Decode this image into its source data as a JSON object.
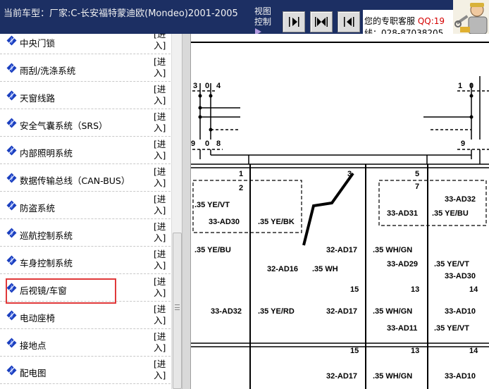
{
  "header": {
    "title": "当前车型：厂家:C-长安福特蒙迪欧(Mondeo)2001-2005",
    "view_control_label": "视图控制",
    "service_label": "您的专职客服",
    "service_qq": "QQ:19",
    "service_phone": "线：028-87038205"
  },
  "sidebar": {
    "enter_label": "[进入]",
    "items": [
      {
        "label": "中央门锁"
      },
      {
        "label": "雨刮/洗涤系统"
      },
      {
        "label": "天窗线路"
      },
      {
        "label": "安全气囊系统（SRS）"
      },
      {
        "label": "内部照明系统"
      },
      {
        "label": "数据传输总线（CAN-BUS）"
      },
      {
        "label": "防盗系统"
      },
      {
        "label": "巡航控制系统"
      },
      {
        "label": "车身控制系统"
      },
      {
        "label": "后视镜/车窗",
        "highlighted": true
      },
      {
        "label": "电动座椅"
      },
      {
        "label": "接地点"
      },
      {
        "label": "配电图"
      }
    ]
  },
  "diagram": {
    "connector_top_left": {
      "pin_a": "3",
      "pin_b": "0",
      "pin_c": "4"
    },
    "connector_top_right": {
      "pin_a": "1",
      "pin_b": "0"
    },
    "connector_mid_left": {
      "pin_a": "9",
      "pin_b": "0",
      "pin_c": "8"
    },
    "connector_mid_right": {
      "pin_a": "9"
    },
    "pins": {
      "p1": "1",
      "p2": "2",
      "p3": "3",
      "p5": "5",
      "p7": "7",
      "p15a": "15",
      "p13a": "13",
      "p14a": "14",
      "p15b": "15",
      "p13b": "13",
      "p14b": "14"
    },
    "wires": {
      "w1": ".35 YE/VT",
      "w2": "33-AD30",
      "w3": ".35 YE/BK",
      "w4": "33-AD31",
      "w5": ".35 YE/BU",
      "w6": "33-AD32",
      "w7": ".35 YE/BU",
      "w8": "32-AD17",
      "w9": ".35 WH/GN",
      "w10": "32-AD16",
      "w11": ".35 WH",
      "w12": "33-AD29",
      "w13": ".35 YE/VT",
      "w14": "33-AD30",
      "w15": "33-AD32",
      "w16": ".35 YE/RD",
      "w17": "32-AD17",
      "w18": ".35 WH/GN",
      "w19": "33-AD10",
      "w20": "33-AD11",
      "w21": ".35 YE/VT",
      "w22": "32-AD17",
      "w23": ".35 WH/GN",
      "w24": "33-AD10"
    }
  },
  "colors": {
    "header_bg": "#1c2f63",
    "highlight": "#e0393a",
    "icon_blue": "#1a3fbf",
    "qq_red": "#d40000"
  }
}
